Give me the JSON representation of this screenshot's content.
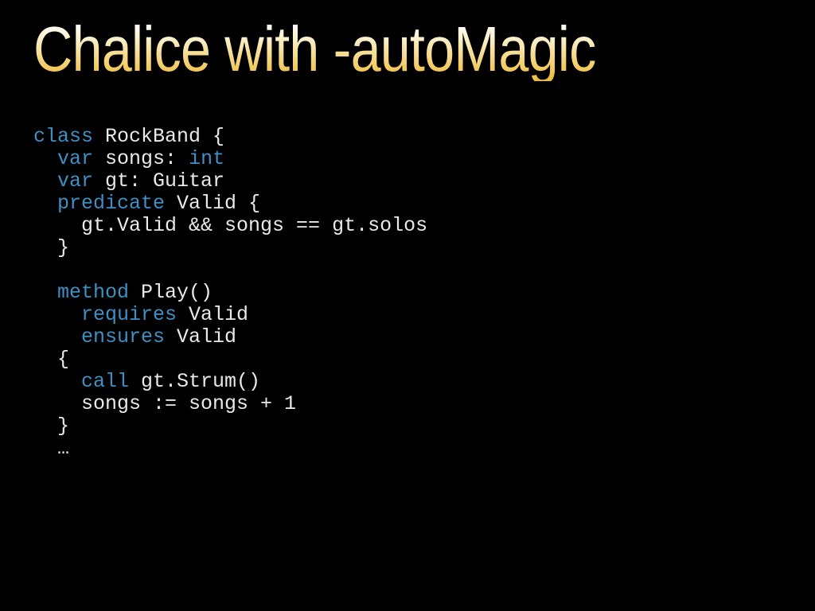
{
  "slide": {
    "background_color": "#000000",
    "title": "Chalice with -autoMagic",
    "title_gradient_top": "#ffffff",
    "title_gradient_bottom": "#e9b942"
  },
  "code": {
    "language": "Chalice",
    "keyword_color": "#3f8fc4",
    "identifier_color": "#e9e9e9",
    "lines": [
      {
        "indent": 0,
        "tokens": [
          {
            "type": "keyword",
            "text": "class"
          },
          {
            "type": "plain",
            "text": " RockBand {"
          }
        ]
      },
      {
        "indent": 2,
        "tokens": [
          {
            "type": "keyword",
            "text": "var"
          },
          {
            "type": "plain",
            "text": " songs: "
          },
          {
            "type": "keyword",
            "text": "int"
          }
        ]
      },
      {
        "indent": 2,
        "tokens": [
          {
            "type": "keyword",
            "text": "var"
          },
          {
            "type": "plain",
            "text": " gt: Guitar"
          }
        ]
      },
      {
        "indent": 2,
        "tokens": [
          {
            "type": "keyword",
            "text": "predicate"
          },
          {
            "type": "plain",
            "text": " Valid {"
          }
        ]
      },
      {
        "indent": 4,
        "tokens": [
          {
            "type": "plain",
            "text": "gt.Valid && songs == gt.solos"
          }
        ]
      },
      {
        "indent": 2,
        "tokens": [
          {
            "type": "plain",
            "text": "}"
          }
        ]
      },
      {
        "indent": 0,
        "tokens": []
      },
      {
        "indent": 2,
        "tokens": [
          {
            "type": "keyword",
            "text": "method"
          },
          {
            "type": "plain",
            "text": " Play()"
          }
        ]
      },
      {
        "indent": 4,
        "tokens": [
          {
            "type": "keyword",
            "text": "requires"
          },
          {
            "type": "plain",
            "text": " Valid"
          }
        ]
      },
      {
        "indent": 4,
        "tokens": [
          {
            "type": "keyword",
            "text": "ensures"
          },
          {
            "type": "plain",
            "text": " Valid"
          }
        ]
      },
      {
        "indent": 2,
        "tokens": [
          {
            "type": "plain",
            "text": "{"
          }
        ]
      },
      {
        "indent": 4,
        "tokens": [
          {
            "type": "keyword",
            "text": "call"
          },
          {
            "type": "plain",
            "text": " gt.Strum()"
          }
        ]
      },
      {
        "indent": 4,
        "tokens": [
          {
            "type": "plain",
            "text": "songs := songs + 1"
          }
        ]
      },
      {
        "indent": 2,
        "tokens": [
          {
            "type": "plain",
            "text": "}"
          }
        ]
      },
      {
        "indent": 2,
        "tokens": [
          {
            "type": "plain",
            "text": "…"
          }
        ]
      }
    ]
  }
}
